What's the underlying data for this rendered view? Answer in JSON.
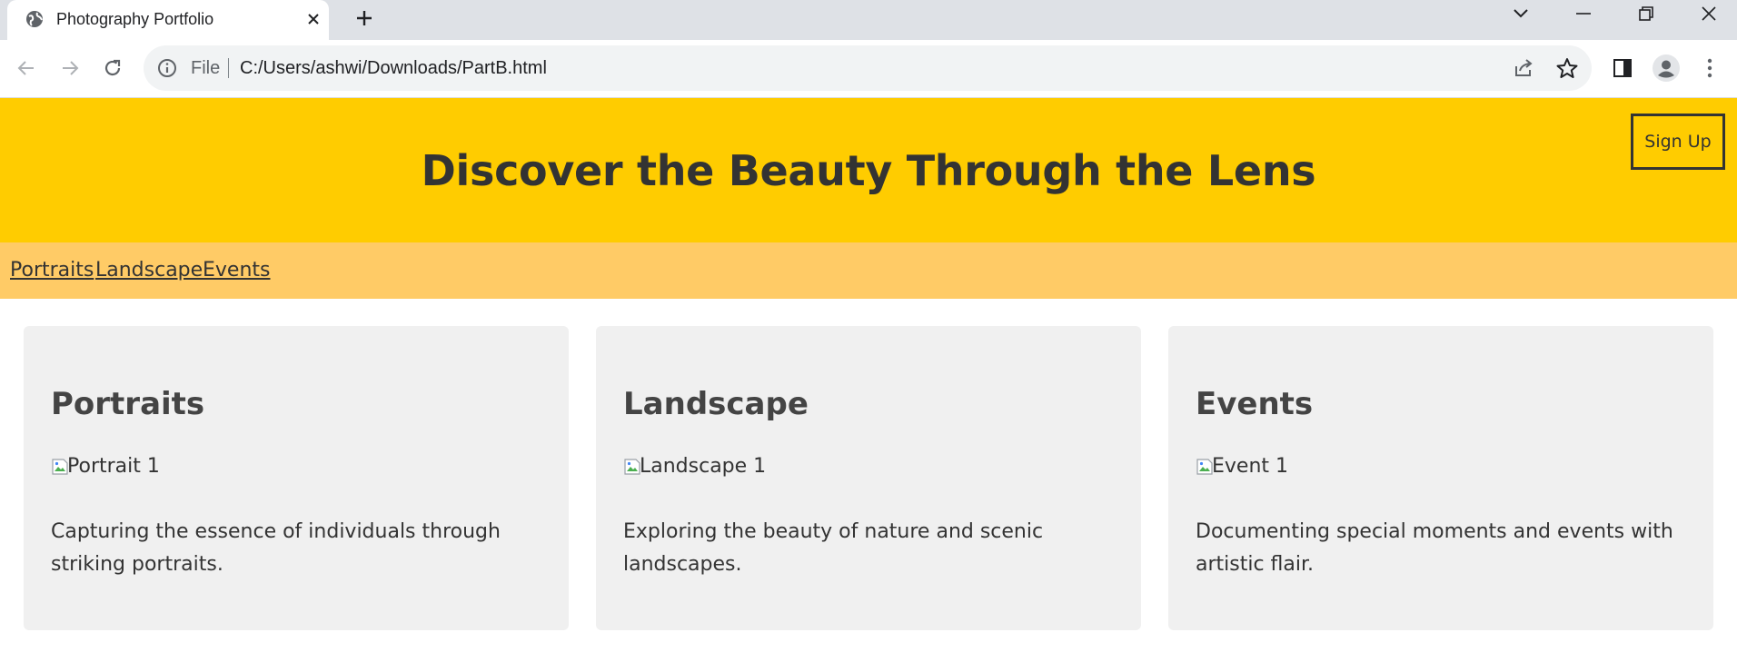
{
  "browser": {
    "tab_title": "Photography Portfolio",
    "favicon": "globe-icon",
    "address": {
      "scheme_label": "File",
      "url": "C:/Users/ashwi/Downloads/PartB.html"
    },
    "icons": [
      "back-icon",
      "forward-icon",
      "reload-icon",
      "info-icon",
      "share-icon",
      "star-icon",
      "side-panel-icon",
      "profile-icon",
      "menu-icon",
      "tab-search-icon",
      "minimize-icon",
      "restore-icon",
      "close-icon",
      "new-tab-icon"
    ]
  },
  "page": {
    "colors": {
      "hero_bg": "#ffcc00",
      "nav_bg": "#ffcb66",
      "card_bg": "#f0f0f0",
      "text": "#333333"
    },
    "hero": {
      "title": "Discover the Beauty Through the Lens",
      "signup_label": "Sign Up"
    },
    "nav": {
      "links": [
        "Portraits",
        "Landscape",
        "Events"
      ]
    },
    "cards": [
      {
        "title": "Portraits",
        "image_alt": "Portrait 1",
        "description": "Capturing the essence of individuals through striking portraits."
      },
      {
        "title": "Landscape",
        "image_alt": "Landscape 1",
        "description": "Exploring the beauty of nature and scenic landscapes."
      },
      {
        "title": "Events",
        "image_alt": "Event 1",
        "description": "Documenting special moments and events with artistic flair."
      }
    ]
  }
}
